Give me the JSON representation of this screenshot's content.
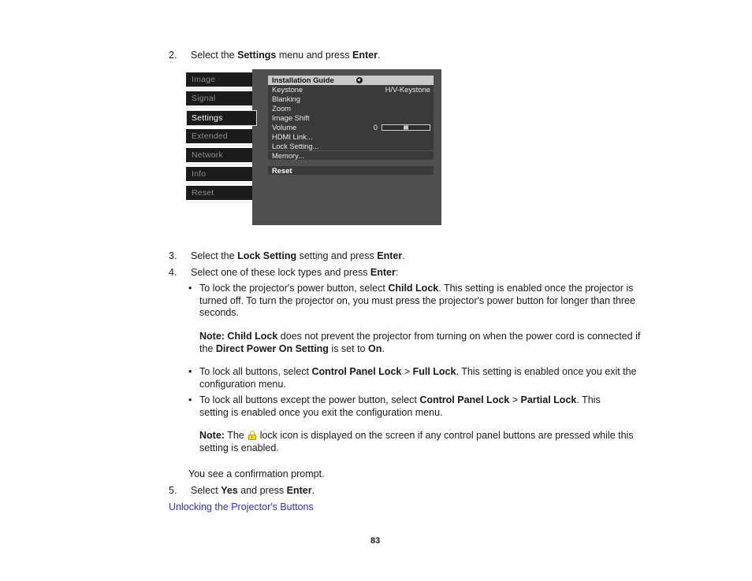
{
  "document": {
    "page_number": "83"
  },
  "steps": {
    "step2": {
      "num": "2.",
      "pre": "Select the ",
      "bold1": "Settings",
      "mid": " menu and press ",
      "bold2": "Enter",
      "post": "."
    },
    "step3": {
      "num": "3.",
      "pre": "Select the ",
      "bold1": "Lock Setting",
      "mid": " setting and press ",
      "bold2": "Enter",
      "post": "."
    },
    "step4": {
      "num": "4.",
      "pre": "Select one of these lock types and press ",
      "bold1": "Enter",
      "post": ":"
    },
    "step5": {
      "num": "5.",
      "pre": "Select ",
      "bold1": "Yes",
      "mid": " and press ",
      "bold2": "Enter",
      "post": "."
    }
  },
  "bullets": {
    "child_lock": {
      "marker": "•",
      "p1": "To lock the projector's power button, select ",
      "b1": "Child Lock",
      "p2": ". This setting is enabled once the projector is turned off. To turn the projector on, you must press the projector's power button for longer than three seconds."
    },
    "full_lock": {
      "marker": "•",
      "p1": "To lock all buttons, select ",
      "b1": "Control Panel Lock",
      "p2": " > ",
      "b2": "Full Lock",
      "p3": ". This setting is enabled once you exit the configuration menu."
    },
    "partial_lock": {
      "marker": "•",
      "p1": "To lock all buttons except the power button, select ",
      "b1": "Control Panel Lock",
      "p2": " > ",
      "b2": "Partial Lock",
      "p3": ". This setting is enabled once you exit the configuration menu."
    }
  },
  "notes": {
    "note1": {
      "label": "Note:",
      "b1": " Child Lock",
      "p1": " does not prevent the projector from turning on when the power cord is connected if the ",
      "b2": "Direct Power On Setting",
      "p2": " is set to ",
      "b3": "On",
      "p3": "."
    },
    "note2": {
      "label": "Note:",
      "p1": " The ",
      "icon": "lock-icon",
      "p2": " lock icon is displayed on the screen if any control panel buttons are pressed while this setting is enabled."
    }
  },
  "confirmation_text": "You see a confirmation prompt.",
  "link": {
    "label": "Unlocking the Projector's Buttons",
    "color": "#2b32d6"
  },
  "osd": {
    "colors": {
      "panel_bg": "#4f4f4f",
      "row_bg": "#3a3a3a",
      "tab_bg": "#1b1b1b",
      "highlight_bg": "#c9c9c9",
      "text": "#e8e8e8",
      "dim_text": "#8b8b8b"
    },
    "tabs": [
      {
        "label": "Image",
        "selected": false
      },
      {
        "label": "Signal",
        "selected": false
      },
      {
        "label": "Settings",
        "selected": true
      },
      {
        "label": "Extended",
        "selected": false
      },
      {
        "label": "Network",
        "selected": false
      },
      {
        "label": "Info",
        "selected": false
      },
      {
        "label": "Reset",
        "selected": false
      }
    ],
    "rows": [
      {
        "label": "Installation Guide",
        "value": "",
        "icon": "guide-icon",
        "highlight": true
      },
      {
        "label": "Keystone",
        "value": "H/V-Keystone",
        "highlight": false
      },
      {
        "label": "Blanking",
        "value": "",
        "highlight": false
      },
      {
        "label": "Zoom",
        "value": "",
        "highlight": false
      },
      {
        "label": "Image Shift",
        "value": "",
        "highlight": false
      },
      {
        "label": "Volume",
        "value": "0",
        "slider": true,
        "highlight": false
      },
      {
        "label": "HDMI Link...",
        "value": "",
        "highlight": false
      },
      {
        "label": "Lock Setting...",
        "value": "",
        "highlight": false
      },
      {
        "label": "Memory...",
        "value": "",
        "highlight": false
      }
    ],
    "reset_row": {
      "label": "Reset"
    },
    "volume": {
      "value": "0",
      "position_percent": 50
    }
  }
}
